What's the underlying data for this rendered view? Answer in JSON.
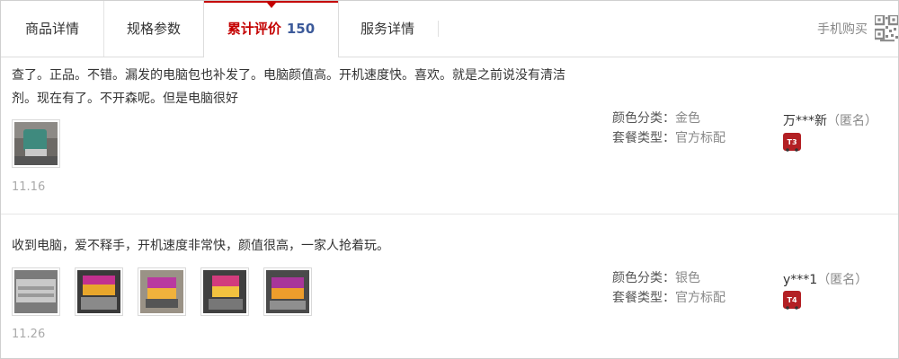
{
  "tabs": [
    {
      "label": "商品详情"
    },
    {
      "label": "规格参数"
    },
    {
      "label": "累计评价",
      "count": "150"
    },
    {
      "label": "服务详情"
    }
  ],
  "mobile_buy": {
    "label": "手机购买",
    "icon": "qr-code-icon"
  },
  "reviews": [
    {
      "text": "查了。正品。不错。漏发的电脑包也补发了。电脑颜值高。开机速度快。喜欢。就是之前说没有清洁剂。现在有了。不开森呢。但是电脑很好",
      "date": "11.16",
      "color_key": "颜色分类：",
      "color_val": "金色",
      "pkg_key": "套餐类型：",
      "pkg_val": "官方标配",
      "user": "万***新",
      "anon": "（匿名）",
      "level": "T3",
      "photo_count": 1
    },
    {
      "text": "收到电脑，爱不释手，开机速度非常快，颜值很高，一家人抢着玩。",
      "date": "11.26",
      "color_key": "颜色分类：",
      "color_val": "银色",
      "pkg_key": "套餐类型：",
      "pkg_val": "官方标配",
      "user": "y***1",
      "anon": "（匿名）",
      "level": "T4",
      "photo_count": 5
    }
  ],
  "colors": {
    "accent": "#c40000",
    "count": "#3c5a9a",
    "badge": "#b32024"
  }
}
